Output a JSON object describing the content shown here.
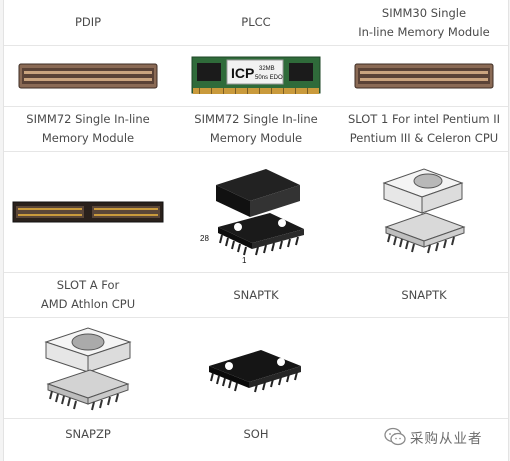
{
  "rows": [
    {
      "labels": [
        "PDIP",
        "PLCC",
        "SIMM30 Single\nIn-line Memory Module"
      ]
    },
    {
      "labels": [
        "SIMM72 Single In-line\nMemory Module",
        "SIMM72 Single In-line\nMemory Module",
        "SLOT 1 For intel Pentium II\nPentium III & Celeron CPU"
      ]
    },
    {
      "labels": [
        "SLOT A For\nAMD Athlon CPU",
        "SNAPTK",
        "SNAPTK"
      ]
    },
    {
      "labels": [
        "SNAPZP",
        "SOH",
        ""
      ]
    }
  ],
  "images": {
    "plcc_brand": "ICP",
    "plcc_spec1": "32MB",
    "plcc_spec2": "50ns EDO",
    "snaptk_pin_a": "28",
    "snaptk_pin_b": "1"
  },
  "watermark": {
    "text": "采购从业者",
    "icon": "wechat-icon"
  },
  "colors": {
    "pcb_green": "#2f6b3a",
    "socket_brown": "#8a6a55",
    "gold": "#c99a3c",
    "line": "#e6e6e6"
  }
}
